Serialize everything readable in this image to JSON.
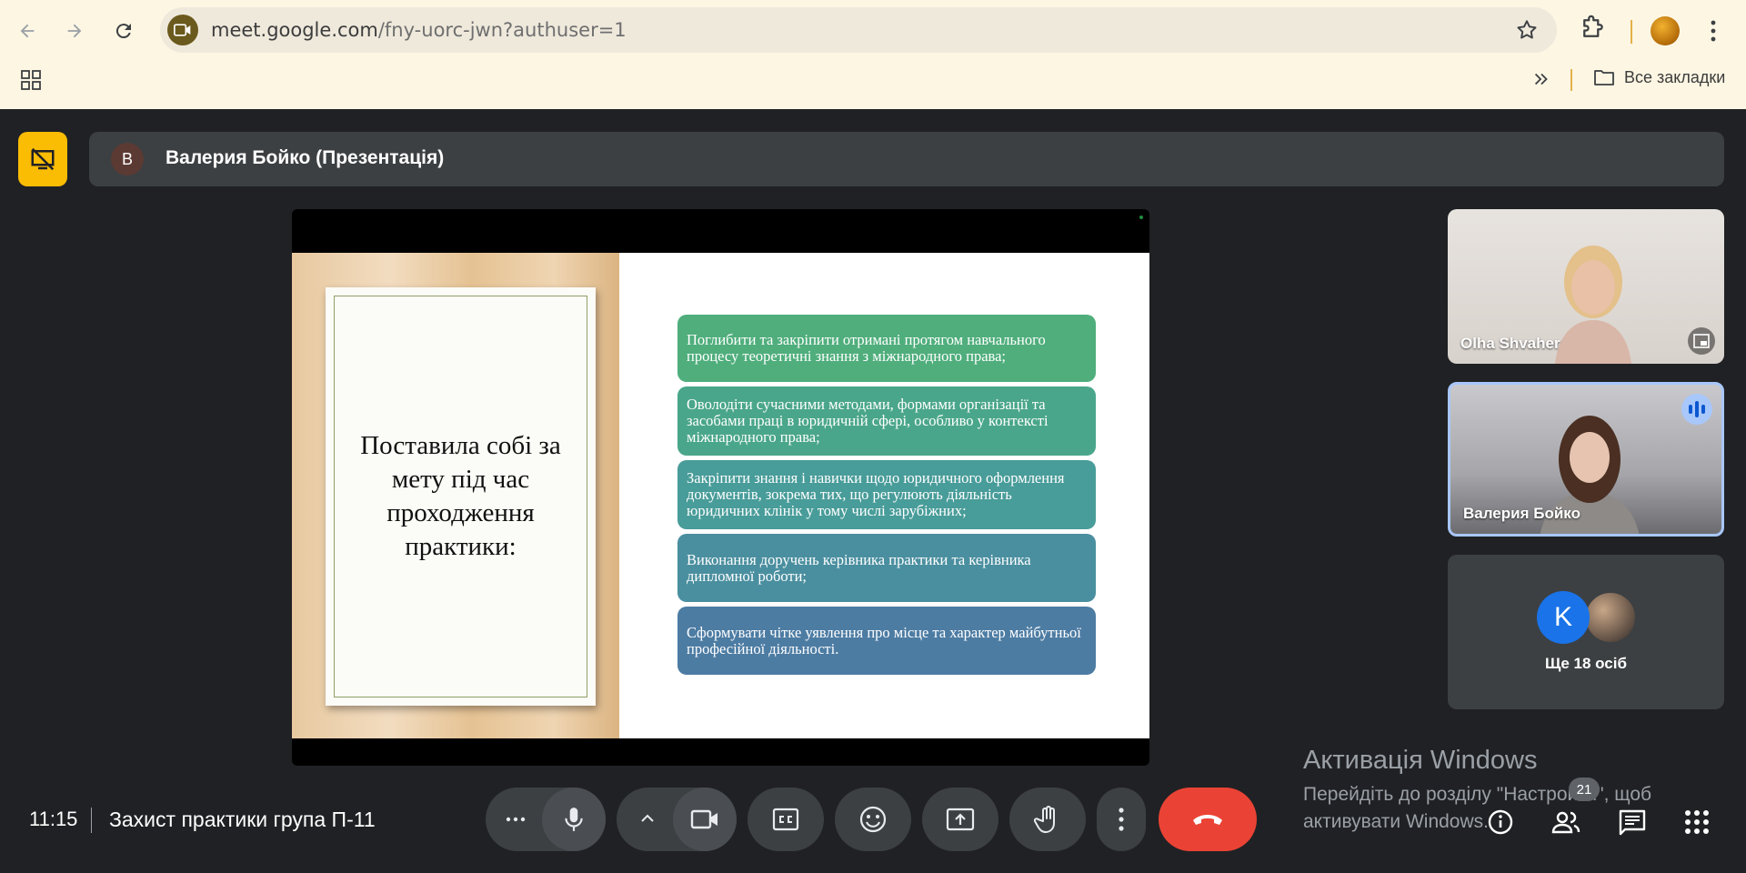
{
  "browser": {
    "url_host": "meet.google.com",
    "url_path": "/fny-uorc-jwn?authuser=1",
    "bookmarks_label": "Все закладки"
  },
  "presenter": {
    "avatar_letter": "В",
    "label": "Валерия Бойко (Презентація)"
  },
  "slide": {
    "card_text": "Поставила собі за мету під час проходження практики:",
    "bullets": [
      {
        "text": "Поглибити та закріпити отримані протягом навчального процесу теоретичні знання з міжнародного права;",
        "color": "#4fae7c"
      },
      {
        "text": "Оволодіти сучасними методами, формами організації та засобами праці в юридичній сфері, особливо у контексті міжнародного права;",
        "color": "#4aa68a"
      },
      {
        "text": "Закріпити знання і навички щодо юридичного оформлення документів, зокрема тих, що регулюють діяльність юридичних клінік у тому числі зарубіжних;",
        "color": "#489c99"
      },
      {
        "text": "Виконання доручень керівника практики та керівника дипломної роботи;",
        "color": "#4a8f9f"
      },
      {
        "text": "Сформувати чітке уявлення про місце та характер майбутньої професійної діяльності.",
        "color": "#4d7ca3"
      }
    ]
  },
  "participants": {
    "tile1_name": "Olha Shvaher",
    "tile2_name": "Валерия Бойко",
    "more_letter": "K",
    "more_label": "Ще 18 осіб"
  },
  "bottom": {
    "time": "11:15",
    "meeting_name": "Захист практики група П-11",
    "people_count": "21"
  },
  "activation": {
    "title": "Активація Windows",
    "subtitle": "Перейдіть до розділу \"Настройки\", щоб активувати Windows."
  }
}
